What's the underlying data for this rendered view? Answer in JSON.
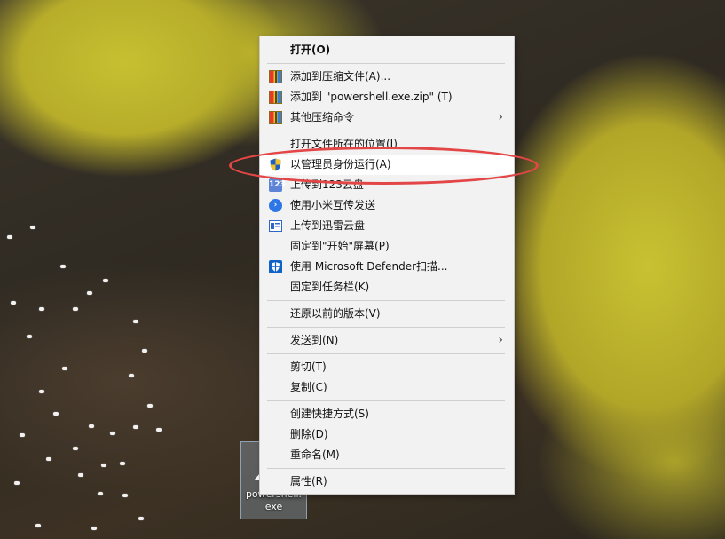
{
  "desktop": {
    "icon": {
      "name": "powershell.\nexe"
    }
  },
  "menu": {
    "open": "打开(O)",
    "add_archive": "添加到压缩文件(A)...",
    "add_zip": "添加到 \"powershell.exe.zip\" (T)",
    "other_compress": "其他压缩命令",
    "open_location": "打开文件所在的位置(I)",
    "run_as_admin": "以管理员身份运行(A)",
    "upload_123": "上传到123云盘",
    "mi_share": "使用小米互传发送",
    "upload_xunlei": "上传到迅雷云盘",
    "pin_start": "固定到\"开始\"屏幕(P)",
    "defender_scan": "使用 Microsoft Defender扫描...",
    "pin_taskbar": "固定到任务栏(K)",
    "restore_versions": "还原以前的版本(V)",
    "send_to": "发送到(N)",
    "cut": "剪切(T)",
    "copy": "复制(C)",
    "create_shortcut": "创建快捷方式(S)",
    "delete": "删除(D)",
    "rename": "重命名(M)",
    "properties": "属性(R)"
  },
  "icons": {
    "archive": "archive-icon",
    "shield": "uac-shield-icon",
    "cloud123": "cloud-123-icon",
    "mi": "mi-share-icon",
    "xunlei": "xunlei-icon",
    "defender": "defender-icon",
    "chevron": "chevron-right-icon"
  },
  "colors": {
    "menu_bg": "#f2f2f2",
    "highlight": "#ffffff",
    "annotation": "#e24646"
  }
}
